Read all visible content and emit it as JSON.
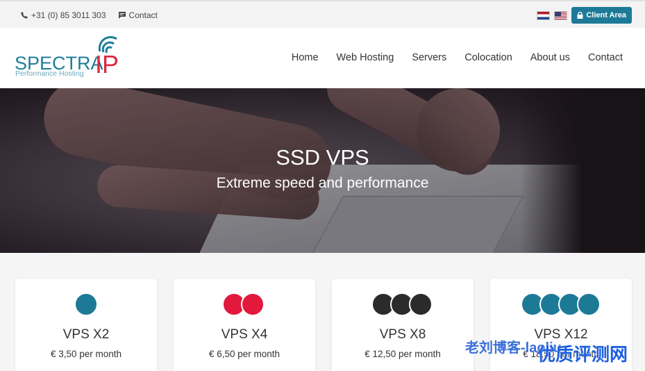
{
  "topbar": {
    "phone": "+31 (0) 85 3011 303",
    "contact": "Contact",
    "client_area": "Client Area"
  },
  "logo": {
    "name_main": "SPECTRA",
    "name_accent": "IP",
    "tagline": "Performance Hosting"
  },
  "nav": {
    "items": [
      "Home",
      "Web Hosting",
      "Servers",
      "Colocation",
      "About us",
      "Contact"
    ]
  },
  "hero": {
    "title": "SSD VPS",
    "subtitle": "Extreme speed and performance"
  },
  "plans": [
    {
      "name": "VPS X2",
      "price": "€ 3,50 per month",
      "dots": 1,
      "color": "#1d7a97"
    },
    {
      "name": "VPS X4",
      "price": "€ 6,50 per month",
      "dots": 2,
      "color": "#e2183c"
    },
    {
      "name": "VPS X8",
      "price": "€ 12,50 per month",
      "dots": 3,
      "color": "#2b2b2b"
    },
    {
      "name": "VPS X12",
      "price": "€ 18,50 per month",
      "dots": 4,
      "color": "#1d7a97"
    }
  ],
  "watermark": {
    "line1": "老刘博客-laoliu",
    "line2": "优质评测网"
  },
  "colors": {
    "brand_blue": "#1d7a97",
    "brand_red": "#e0283e"
  }
}
